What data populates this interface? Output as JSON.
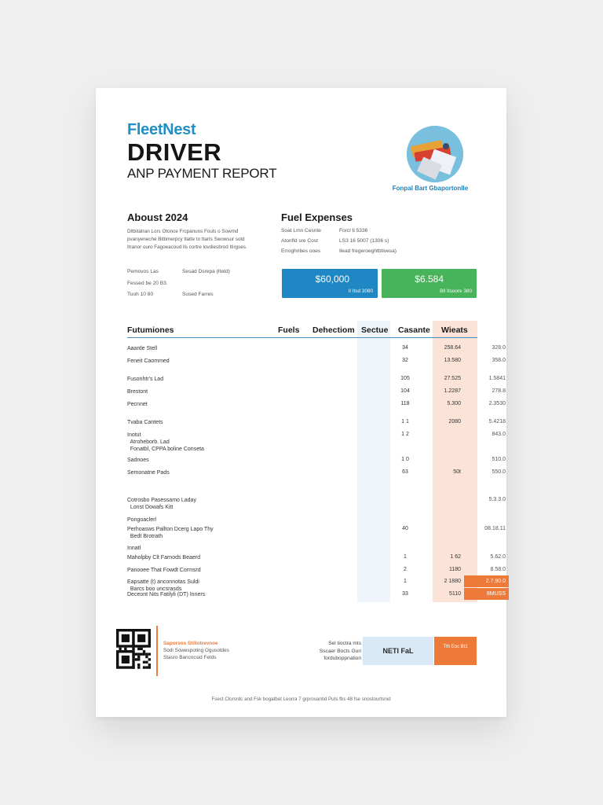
{
  "header": {
    "brand": "FleetNest",
    "title_line1": "DRIVER",
    "title_line2": "ANP PAYMENT REPORT",
    "logo_caption": "Fonpal Bart Gbaportonlle"
  },
  "about": {
    "heading": "Aboust 2024",
    "text": "Dltbitatran Lors Otonce Frcpanuns Fouls o Sowmd pvanyeneche Bitbmerpcy tlatte to ttarts Swowsur sold Itranor ouro Fagoeacoud lls cortre lovdiesbrod Itirgses.",
    "info": [
      [
        "Pemovos Las",
        "Sesad Dsrepa (Itetd)"
      ],
      [
        "Fessed be 20 B3.",
        ""
      ],
      [
        "Tuoh 10 80",
        "Sused Farres"
      ]
    ]
  },
  "fuel": {
    "heading": "Fuel Expenses",
    "rows": [
      [
        "Soat Lmn Cesnte",
        "Forcl ti 5336"
      ],
      [
        "Atonfld sre Cost",
        "LS3 16 5007 (1306 s)"
      ],
      [
        "Erroghnbes ooes",
        "Ilead fregeroeghtbtivesa)"
      ]
    ],
    "card_blue": {
      "value": "$60,000",
      "sub": "Il Itsd 3080"
    },
    "card_green": {
      "value": "$6.584",
      "sub": "Bll Itsoore 380"
    }
  },
  "table": {
    "headers": {
      "category": "Futumiones",
      "fuels": "Fuels",
      "deduction": "Dehectiom",
      "section": "Sectue",
      "casante": "Casante",
      "weight": "Wieats"
    },
    "rows": [
      {
        "label": "Aaarde Stell",
        "v1": "34",
        "v2": "258.64",
        "v3": "328.0",
        "hot": false
      },
      {
        "label": "Feneit Caommed",
        "v1": "32",
        "v2": "13.580",
        "v3": "358.0",
        "hot": false
      },
      {
        "label": "Fusonhtr's Lad",
        "v1": "105",
        "v2": "27.525",
        "v3": "1.5841",
        "hot": false
      },
      {
        "label": "Brestont",
        "v1": "104",
        "v2": "1.2287",
        "v3": "278.8",
        "hot": false
      },
      {
        "label": "Pecnnet",
        "v1": "118",
        "v2": "5.300",
        "v3": "2.3530",
        "hot": false
      },
      {
        "label": "Tvaba Cantets",
        "v1": "1 1",
        "v2": "2080",
        "v3": "5.4218",
        "hot": false
      },
      {
        "label": "Inotut\n  Atroheborb. Lad\n  Fonatbl, CPPA boline Conseta",
        "v1": "1 2",
        "v2": "",
        "v3": "843.0",
        "hot": false
      },
      {
        "label": "Sadnoes",
        "v1": "1 0",
        "v2": "",
        "v3": "510.0",
        "hot": false
      },
      {
        "label": "Semonatne Pads",
        "v1": "63",
        "v2": "50t",
        "v3": "550.0",
        "hot": false
      },
      {
        "label": "Cotrosbo Pasessamo Laday\n  Lonst Dowafs Kitt",
        "v1": "",
        "v2": "",
        "v3": "5.3.3.0",
        "hot": false
      },
      {
        "label": "Pongoaclerl",
        "v1": "",
        "v2": "",
        "v3": "",
        "hot": false
      },
      {
        "label": "Perhoasws Pallton Dcerg Lapo Thy\n  Bedt Brotrath",
        "v1": "40",
        "v2": "",
        "v3": "08.18.11",
        "hot": false
      },
      {
        "label": "Innatl",
        "v1": "",
        "v2": "",
        "v3": "",
        "hot": false
      },
      {
        "label": "Maholpby Clt Farnods Beaerd",
        "v1": "1",
        "v2": "1 62",
        "v3": "5.62.0",
        "hot": false
      },
      {
        "label": "Panooee That Fowdt Cormsrd",
        "v1": "2",
        "v2": "1180",
        "v3": "8.58.0",
        "hot": false
      },
      {
        "label": "Eapsatte (t) anconnotas Suldi\n  Barcs boo uncsrasds",
        "v1": "1",
        "v2": "2 1880",
        "v3": "2.7.90.0",
        "hot": true
      },
      {
        "label": "Deceont Nits Fatilyli (DT) Inners",
        "v1": "33",
        "v2": "5110",
        "v3": "8MUSS",
        "hot": true
      }
    ]
  },
  "footer": {
    "contact_title": "Saporsos Stillotrevnoe",
    "contact_line1": "Sodi Sowespoting Ogusotdes",
    "contact_line2": "Stasro Bancncsid Fetds",
    "net_label": "Sel tioctra mts\nSscaer Bocts Guri\nforduboppnation",
    "net_value": "NETI FaL",
    "net_hot": "Tth Eoc Bt1",
    "note": "Fsect Clorsrdc and Fsk bogatbet Leorra 7 grprovantid Puts fbs 48 fse snostourtsnid"
  },
  "colors": {
    "brand": "#1f8fc4",
    "blue_card": "#1f87c3",
    "green_card": "#47b35b",
    "accent": "#ee7a3a"
  }
}
